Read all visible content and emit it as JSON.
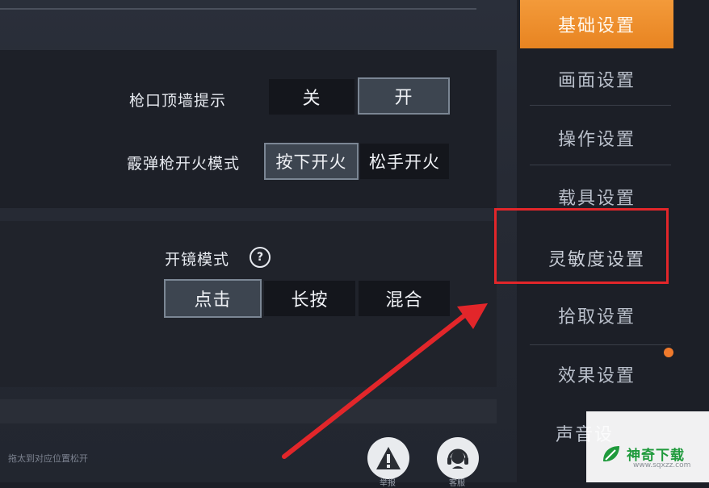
{
  "settings": {
    "muzzle_hint": {
      "label": "枪口顶墙提示",
      "options": [
        "关",
        "开"
      ],
      "selected": "开"
    },
    "shotgun_fire_mode": {
      "label": "霰弹枪开火模式",
      "options": [
        "按下开火",
        "松手开火"
      ],
      "selected": "按下开火"
    },
    "scope_mode": {
      "label": "开镜模式",
      "help_icon": "?",
      "options": [
        "点击",
        "长按",
        "混合"
      ],
      "selected": "点击"
    }
  },
  "sidebar": {
    "items": [
      {
        "label": "基础设置",
        "active": true
      },
      {
        "label": "画面设置"
      },
      {
        "label": "操作设置"
      },
      {
        "label": "载具设置"
      },
      {
        "label": "灵敏度设置",
        "highlighted": true
      },
      {
        "label": "拾取设置"
      },
      {
        "label": "效果设置",
        "badge": true
      },
      {
        "label": "声音设"
      }
    ]
  },
  "footer": {
    "hint": "拖太到对应位置松开",
    "report_icon": "warning-icon",
    "support_icon": "headset-icon",
    "report_label": "举报",
    "support_label": "客服"
  },
  "watermark": {
    "name": "神奇下载",
    "url": "www.sqxzz.com"
  },
  "colors": {
    "accent": "#f39a3a",
    "highlight": "#e2262a",
    "badge": "#f07a2c",
    "watermark": "#1f9a3c"
  }
}
